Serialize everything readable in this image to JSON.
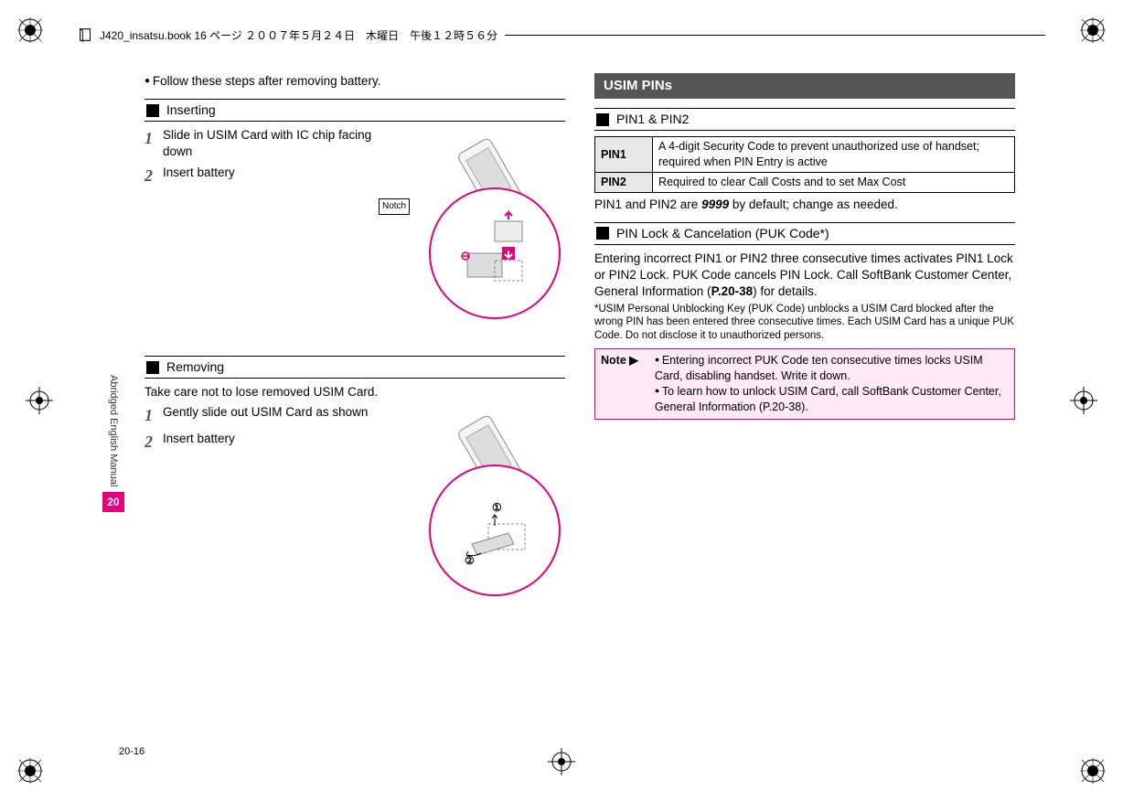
{
  "meta": {
    "header": "J420_insatsu.book  16 ページ  ２００７年５月２４日　木曜日　午後１２時５６分"
  },
  "side": {
    "label": "Abridged English Manual",
    "chapter": "20"
  },
  "footer": {
    "page": "20-16"
  },
  "left": {
    "intro": "Follow these steps after removing battery.",
    "inserting": {
      "title": "Inserting",
      "steps": [
        "Slide in USIM Card with IC chip facing down",
        "Insert battery"
      ],
      "notch": "Notch"
    },
    "removing": {
      "title": "Removing",
      "intro": "Take care not to lose removed USIM Card.",
      "steps": [
        "Gently slide out USIM Card as shown",
        "Insert battery"
      ]
    }
  },
  "right": {
    "main_title": "USIM PINs",
    "pin_section": "PIN1 & PIN2",
    "table": {
      "r1h": "PIN1",
      "r1": "A 4-digit Security Code to prevent unauthorized use of handset; required when PIN Entry is active",
      "r2h": "PIN2",
      "r2": "Required to clear Call Costs and to set Max Cost"
    },
    "default_line_a": "PIN1 and PIN2 are ",
    "default_line_b": "9999",
    "default_line_c": " by default; change as needed.",
    "lock_section": "PIN Lock & Cancelation (PUK Code*)",
    "lock_body_a": "Entering incorrect PIN1 or PIN2 three consecutive times activates PIN1 Lock or PIN2 Lock. PUK Code cancels PIN Lock. Call SoftBank Customer Center, General Information (",
    "lock_body_b": "P.20-38",
    "lock_body_c": ") for details.",
    "asterisk": "*USIM Personal Unblocking Key (PUK Code) unblocks a USIM Card blocked after the wrong PIN has been entered three consecutive times. Each USIM Card has a unique PUK Code. Do not disclose it to unauthorized persons.",
    "note_label": "Note ▶",
    "note_items": [
      "Entering incorrect PUK Code ten consecutive times locks USIM Card, disabling handset. Write it down.",
      "To learn how to unlock USIM Card, call SoftBank Customer Center, General Information (P.20-38)."
    ]
  }
}
